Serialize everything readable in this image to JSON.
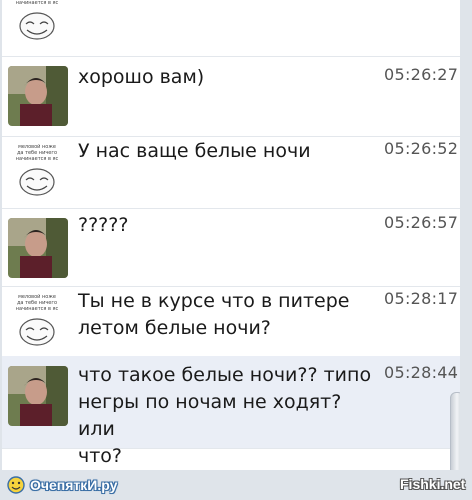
{
  "meme_caption": "меловой ноже\nда тебе ничего\nначинается в яс",
  "messages": [
    {
      "sender": "meme",
      "text": "",
      "time": ""
    },
    {
      "sender": "photo",
      "text": "хорошо вам)",
      "time": "05:26:27"
    },
    {
      "sender": "meme",
      "text": "У нас ваще белые ночи",
      "time": "05:26:52"
    },
    {
      "sender": "photo",
      "text": "?????",
      "time": "05:26:57"
    },
    {
      "sender": "meme",
      "text": "Ты не в курсе что в питере\nлетом белые ночи?",
      "time": "05:28:17"
    },
    {
      "sender": "photo",
      "text": "что такое белые ночи?? типо\nнегры по ночам не ходят? или\nчто?",
      "time": "05:28:44"
    }
  ],
  "watermark_left": "ОчепяткИ.ру",
  "watermark_right": "Fishki.net"
}
